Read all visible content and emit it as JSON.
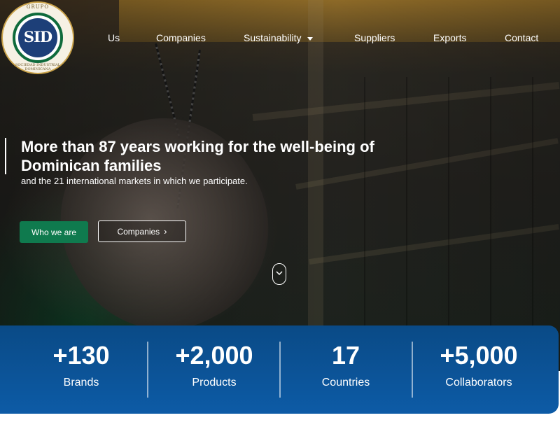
{
  "logo": {
    "top_text": "GRUPO",
    "monogram": "SID",
    "bottom_text": "SOCIEDAD INDUSTRIAL DOMINICANA"
  },
  "nav": {
    "items": [
      {
        "label": "Us"
      },
      {
        "label": "Companies"
      },
      {
        "label": "Sustainability"
      },
      {
        "label": "Suppliers"
      },
      {
        "label": "Exports"
      },
      {
        "label": "Contact"
      }
    ]
  },
  "hero": {
    "headline": "More than 87 years working for the well-being of Dominican families",
    "subline": "and the 21 international markets in which we participate.",
    "primary_button": "Who we are",
    "secondary_button": "Companies",
    "accent_color": "#0f7a4e"
  },
  "stats": [
    {
      "value": "+130",
      "label": "Brands"
    },
    {
      "value": "+2,000",
      "label": "Products"
    },
    {
      "value": "17",
      "label": "Countries"
    },
    {
      "value": "+5,000",
      "label": "Collaborators"
    }
  ],
  "colors": {
    "stats_bg": "#0d5ba6",
    "green": "#0f7a4e"
  }
}
